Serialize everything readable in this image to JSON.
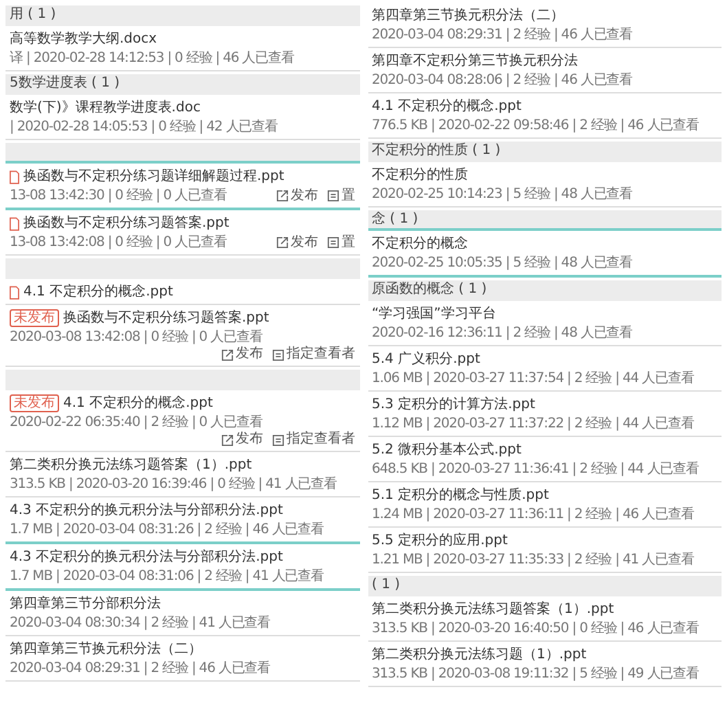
{
  "columns": [
    {
      "items": [
        {
          "kind": "header",
          "text": "用 ( 1 )",
          "highlighted": false
        },
        {
          "kind": "file",
          "title": "高等数学教学大纲.docx",
          "meta": "译 | 2020-02-28 14:12:53 | 0 经验 | 46 人已查看",
          "highlighted": false
        },
        {
          "kind": "header",
          "text": "5数学进度表 ( 1 )",
          "highlighted": false
        },
        {
          "kind": "file",
          "title": "数学(下)》课程教学进度表.doc",
          "meta": "| 2020-02-28 14:05:53 | 0 经验 | 42 人已查看",
          "highlighted": false
        },
        {
          "kind": "header",
          "highlighted": true
        },
        {
          "kind": "file",
          "file_icon": true,
          "title": "换函数与不定积分练习题详细解题过程.ppt",
          "meta": "13-08 13:42:30 | 0 经验 | 0 人已查看",
          "actions": [
            {
              "kind": "publish",
              "label": "发布"
            },
            {
              "kind": "assign",
              "label": "置"
            }
          ],
          "highlighted": true
        },
        {
          "kind": "file",
          "file_icon": true,
          "title": "换函数与不定积分练习题答案.ppt",
          "meta": "13-08 13:42:08 | 0 经验 | 0 人已查看",
          "actions": [
            {
              "kind": "publish",
              "label": "发布"
            },
            {
              "kind": "assign",
              "label": "置"
            }
          ],
          "highlighted": false
        },
        {
          "kind": "header",
          "highlighted": false
        },
        {
          "kind": "file",
          "file_icon": true,
          "title": "4.1 不定积分的概念.ppt",
          "highlighted": false
        },
        {
          "kind": "file",
          "badge": "未发布",
          "title": "换函数与不定积分练习题答案.ppt",
          "meta": "2020-03-08 13:42:08 | 0 经验 | 0 人已查看",
          "actions": [
            {
              "kind": "publish",
              "label": "发布"
            },
            {
              "kind": "assign",
              "label": "指定查看者"
            }
          ],
          "highlighted": false
        },
        {
          "kind": "header",
          "highlighted": false
        },
        {
          "kind": "file",
          "badge": "未发布",
          "title": "4.1 不定积分的概念.ppt",
          "meta": "2020-02-22 06:35:40 | 2 经验 | 0 人已查看",
          "actions": [
            {
              "kind": "publish",
              "label": "发布"
            },
            {
              "kind": "assign",
              "label": "指定查看者"
            }
          ],
          "highlighted": false
        },
        {
          "kind": "file",
          "title": "第二类积分换元法练习题答案（1）.ppt",
          "meta": "313.5 KB | 2020-03-20 16:39:46 | 0 经验 | 41 人已查看",
          "highlighted": false
        },
        {
          "kind": "file",
          "title": "4.3 不定积分的换元积分法与分部积分法.ppt",
          "meta": "1.7 MB | 2020-03-04 08:31:26 | 2 经验 | 46 人已查看",
          "highlighted": true
        },
        {
          "kind": "file",
          "title": "4.3 不定积分的换元积分法与分部积分法.ppt",
          "meta": "1.7 MB | 2020-03-04 08:31:06 | 2 经验 | 41 人已查看",
          "highlighted": true
        },
        {
          "kind": "file",
          "title": "第四章第三节分部积分法",
          "meta": "2020-03-04 08:30:34 | 2 经验 | 41 人已查看",
          "highlighted": false
        },
        {
          "kind": "file",
          "title": "第四章第三节换元积分法（二）",
          "meta": "2020-03-04 08:29:31 | 2 经验 | 46 人已查看",
          "highlighted": false
        }
      ]
    },
    {
      "items": [
        {
          "kind": "file",
          "title": "第四章第三节换元积分法（二）",
          "meta": "2020-03-04 08:29:31 | 2 经验 | 46 人已查看",
          "highlighted": false
        },
        {
          "kind": "file",
          "title": "第四章不定积分第三节换元积分法",
          "meta": "2020-03-04 08:28:06 | 2 经验 | 46 人已查看",
          "highlighted": false
        },
        {
          "kind": "file",
          "title": "4.1 不定积分的概念.ppt",
          "meta": "776.5 KB | 2020-02-22 09:58:46 | 2 经验 | 46 人已查看",
          "highlighted": false
        },
        {
          "kind": "header",
          "text": "不定积分的性质 ( 1 )",
          "highlighted": false
        },
        {
          "kind": "file",
          "title": "不定积分的性质",
          "meta": "2020-02-25 10:14:23 | 5 经验 | 48 人已查看",
          "highlighted": false
        },
        {
          "kind": "header",
          "text": "念 ( 1 )",
          "highlighted": true
        },
        {
          "kind": "file",
          "title": "不定积分的概念",
          "meta": "2020-02-25 10:05:35 | 5 经验 | 48 人已查看",
          "highlighted": true
        },
        {
          "kind": "header",
          "text": "原函数的概念 ( 1 )",
          "highlighted": false
        },
        {
          "kind": "file",
          "title": "“学习强国”学习平台",
          "meta": "2020-02-16 12:36:11 | 2 经验 | 48 人已查看",
          "highlighted": false
        },
        {
          "kind": "file",
          "title": "5.4 广义积分.ppt",
          "meta": "1.06 MB | 2020-03-27 11:37:54 | 2 经验 | 44 人已查看",
          "highlighted": false
        },
        {
          "kind": "file",
          "title": "5.3 定积分的计算方法.ppt",
          "meta": "1.12 MB | 2020-03-27 11:37:22 | 2 经验 | 44 人已查看",
          "highlighted": false
        },
        {
          "kind": "file",
          "title": "5.2 微积分基本公式.ppt",
          "meta": "648.5 KB | 2020-03-27 11:36:41 | 2 经验 | 44 人已查看",
          "highlighted": false
        },
        {
          "kind": "file",
          "title": "5.1 定积分的概念与性质.ppt",
          "meta": "1.24 MB | 2020-03-27 11:36:11 | 2 经验 | 46 人已查看",
          "highlighted": false
        },
        {
          "kind": "file",
          "title": "5.5 定积分的应用.ppt",
          "meta": "1.21 MB | 2020-03-27 11:35:33 | 2 经验 | 41 人已查看",
          "highlighted": false
        },
        {
          "kind": "header",
          "text": "( 1 )",
          "highlighted": false
        },
        {
          "kind": "file",
          "title": "第二类积分换元法练习题答案（1）.ppt",
          "meta": "313.5 KB | 2020-03-20 16:40:50 | 0 经验 | 46 人已查看",
          "highlighted": false
        },
        {
          "kind": "file",
          "title": "第二类积分换元法练习题（1）.ppt",
          "meta": "313.5 KB | 2020-03-08 19:11:32 | 5 经验 | 49 人已查看",
          "highlighted": false
        }
      ]
    }
  ]
}
